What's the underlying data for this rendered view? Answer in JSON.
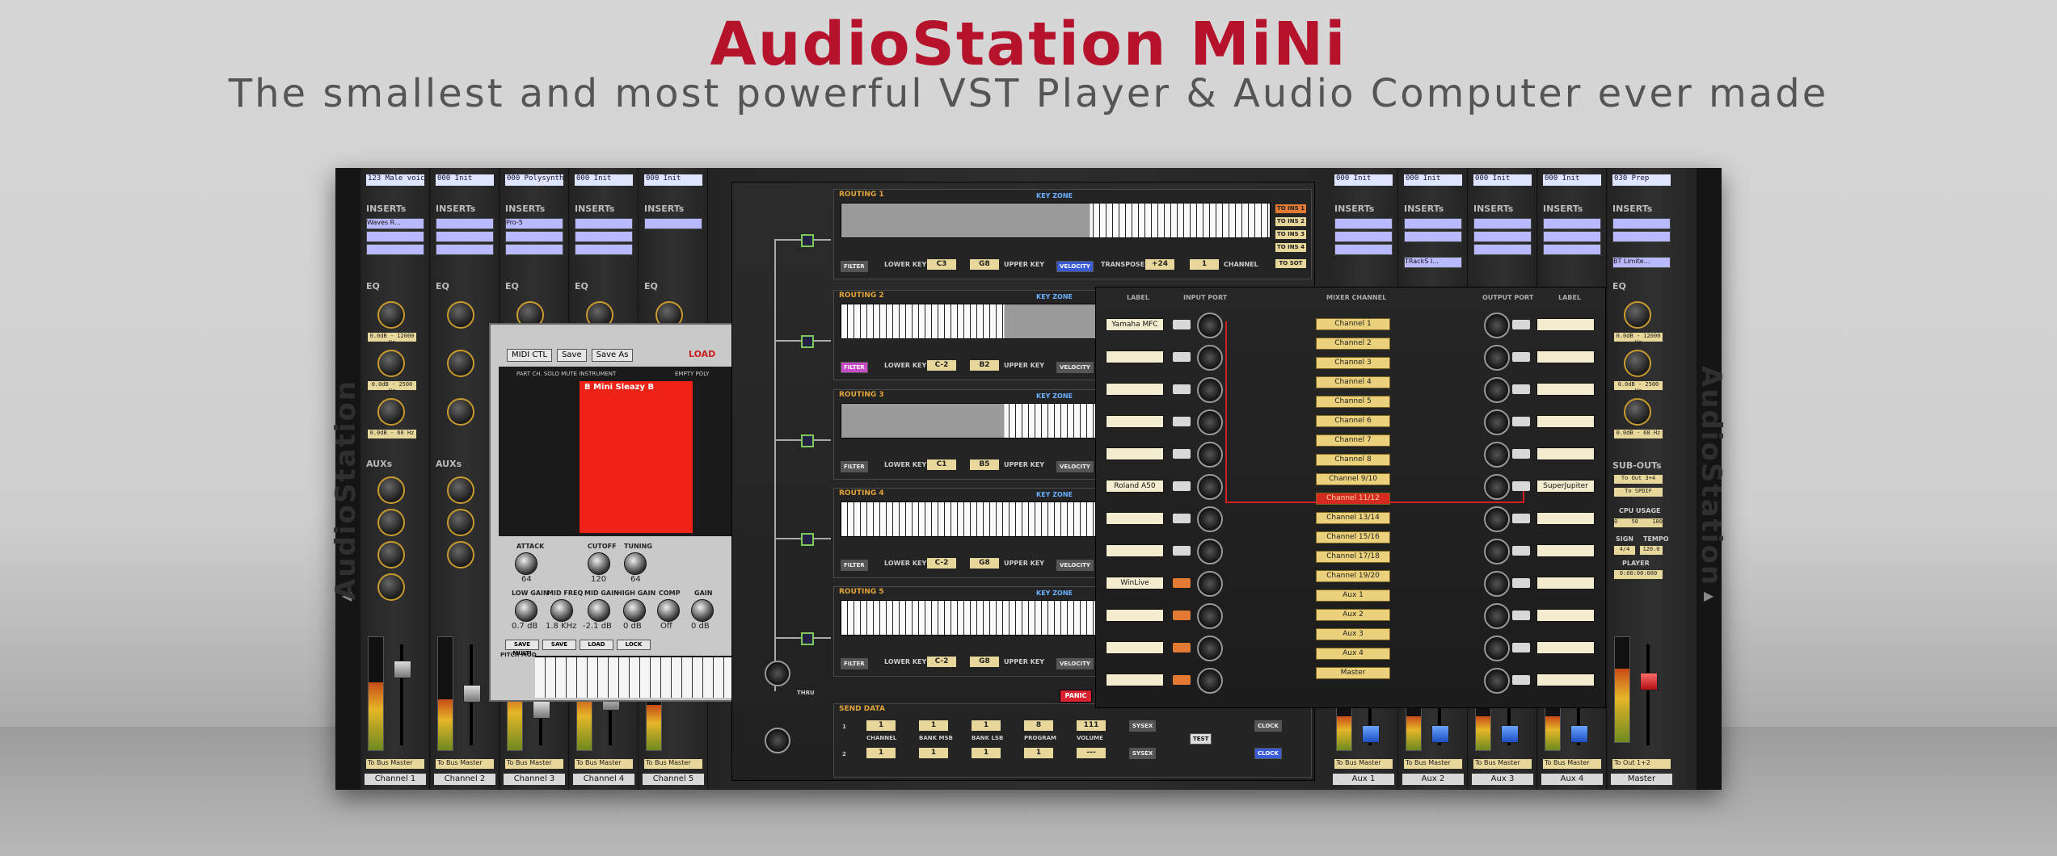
{
  "hero": {
    "title": "AudioStation MiNi",
    "subtitle": "The smallest and most powerful VST Player & Audio Computer ever made"
  },
  "rack": {
    "brand": "AudioStation",
    "section_inserts": "INSERTs",
    "section_eq": "EQ",
    "section_auxs": "AUXs",
    "section_subouts": "SUB-OUTs",
    "cpu_label": "CPU USAGE",
    "sign_label": "SIGN",
    "tempo_label": "TEMPO",
    "player_label": "PLAYER",
    "signature": "4/4",
    "tempo": "120.0",
    "time": "0:00:00:000",
    "sub_out_1": "To Out 3+4",
    "sub_out_2": "To SPDIF",
    "cpu_a": "0",
    "cpu_b": "50",
    "cpu_c": "100",
    "superjupiter": "SuperJupiter"
  },
  "strips_left": [
    {
      "preset": "123 Male voice",
      "insert": "Waves R...",
      "eq_hi": "0.0dB - 12000 Hz",
      "eq_mid": "0.0dB - 2500 Hz",
      "eq_lo": "0.0dB - 60 Hz",
      "bus": "To Bus Master",
      "name": "Channel 1"
    },
    {
      "preset": "000 Init",
      "insert": "",
      "eq_hi": "",
      "eq_mid": "",
      "eq_lo": "",
      "bus": "To Bus Master",
      "name": "Channel 2"
    },
    {
      "preset": "000 Polysynth...",
      "insert": "Pro-5",
      "eq_hi": "",
      "eq_mid": "",
      "eq_lo": "",
      "bus": "To Bus Master",
      "name": "Channel 3"
    },
    {
      "preset": "000 Init",
      "insert": "",
      "eq_hi": "",
      "eq_mid": "",
      "eq_lo": "",
      "bus": "To Bus Master",
      "name": "Channel 4"
    },
    {
      "preset": "000 Init",
      "insert": "",
      "eq_hi": "",
      "eq_mid": "",
      "eq_lo": "",
      "bus": "To Bus Master",
      "name": "Channel 5"
    }
  ],
  "strips_right": [
    {
      "preset": "000 Init",
      "insert": "",
      "bus": "To Bus Master",
      "name": "Aux 1"
    },
    {
      "preset": "000 Init",
      "insert": "TRackS I...",
      "bus": "To Bus Master",
      "name": "Aux 2"
    },
    {
      "preset": "000 Init",
      "insert": "",
      "bus": "To Bus Master",
      "name": "Aux 3"
    },
    {
      "preset": "000 Init",
      "insert": "",
      "bus": "To Bus Master",
      "name": "Aux 4"
    },
    {
      "preset": "030 Prep",
      "insert": "BT Limite...",
      "bus": "To Out 1+2",
      "name": "Master",
      "eq_hi": "0.0dB - 12000 Hz",
      "eq_mid": "0.0dB - 2500 Hz",
      "eq_lo": "0.0dB - 60 Hz"
    }
  ],
  "vsti": {
    "buttons": [
      "MIDI CTL",
      "Save",
      "Save As"
    ],
    "load": "LOAD",
    "patch": "B Mini Sleazy B",
    "columns": "PART  CH. SOLO MUTE INSTRUMENT",
    "empty_poly": "EMPTY POLY",
    "knobs": [
      {
        "label": "ATTACK",
        "value": "64"
      },
      {
        "label": "CUTOFF",
        "value": "120"
      },
      {
        "label": "TUNING",
        "value": "64"
      }
    ],
    "knobs2": [
      {
        "label": "LOW GAIN",
        "value": "0.7 dB"
      },
      {
        "label": "MID FREQ",
        "value": "1.8 KHz"
      },
      {
        "label": "MID GAIN",
        "value": "-2.1 dB"
      },
      {
        "label": "HIGH GAIN",
        "value": "0 dB"
      },
      {
        "label": "COMP",
        "value": "Off"
      },
      {
        "label": "GAIN",
        "value": "0 dB"
      }
    ],
    "tbuttons": [
      "SAVE MULTI",
      "SAVE",
      "LOAD",
      "LOCK"
    ],
    "pitch_mod": "PITCH MOD"
  },
  "routing": {
    "key_zone": "KEY ZONE",
    "lower_key_label": "LOWER KEY",
    "upper_key_label": "UPPER KEY",
    "filter": "FILTER",
    "velocity": "VELOCITY",
    "transpose": "TRANSPOSE",
    "channel": "CHANNEL",
    "thru": "THRU",
    "panic": "PANIC",
    "panels": [
      {
        "title": "ROUTING 1",
        "lower": "C3",
        "upper": "G8",
        "transpose": "+24",
        "channel": "1"
      },
      {
        "title": "ROUTING 2",
        "lower": "C-2",
        "upper": "B2"
      },
      {
        "title": "ROUTING 3",
        "lower": "C1",
        "upper": "B5"
      },
      {
        "title": "ROUTING 4",
        "lower": "C-2",
        "upper": "G8"
      },
      {
        "title": "ROUTING 5",
        "lower": "C-2",
        "upper": "G8"
      }
    ],
    "outs": [
      "TO INS 1",
      "TO INS 2",
      "TO INS 3",
      "TO INS 4",
      "TO SOT"
    ],
    "send": {
      "title": "SEND DATA",
      "cols": [
        "CHANNEL",
        "BANK MSB",
        "BANK LSB",
        "PROGRAM",
        "VOLUME"
      ],
      "row1": [
        "1",
        "1",
        "1",
        "8",
        "111"
      ],
      "row2": [
        "1",
        "1",
        "1",
        "1",
        "---"
      ],
      "sysex": "SYSEX",
      "test": "TEST",
      "clock": "CLOCK"
    }
  },
  "mixer": {
    "head_label": "LABEL",
    "head_input": "INPUT PORT",
    "head_mixer": "MIXER CHANNEL",
    "head_output": "OUTPUT PORT",
    "inputs": [
      "Yamaha MFC",
      "",
      "",
      "",
      "",
      "Roland A50",
      "",
      "",
      "WinLive",
      "",
      "",
      ""
    ],
    "channels": [
      "Channel 1",
      "Channel 2",
      "Channel 3",
      "Channel 4",
      "Channel 5",
      "Channel 6",
      "Channel 7",
      "Channel 8",
      "Channel 9/10",
      "Channel 11/12",
      "Channel 13/14",
      "Channel 15/16",
      "Channel 17/18",
      "Channel 19/20",
      "Aux 1",
      "Aux 2",
      "Aux 3",
      "Aux 4",
      "Master"
    ],
    "selected_channel": "Channel 11/12"
  }
}
